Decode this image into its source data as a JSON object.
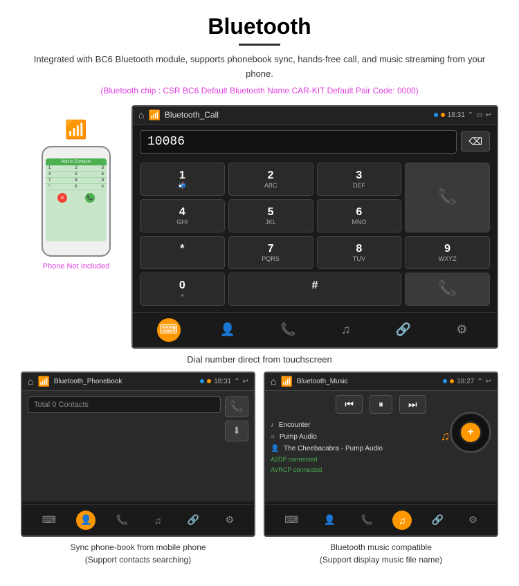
{
  "header": {
    "title": "Bluetooth",
    "subtitle": "Integrated with BC6 Bluetooth module, supports phonebook sync, hands-free call, and music streaming from your phone.",
    "specs": "(Bluetooth chip : CSR BC6    Default Bluetooth Name CAR-KIT    Default Pair Code: 0000)"
  },
  "main_screen": {
    "topbar_title": "Bluetooth_Call",
    "time": "18:31",
    "dial_number": "10086",
    "keys": [
      {
        "main": "1",
        "sub": ""
      },
      {
        "main": "2",
        "sub": "ABC"
      },
      {
        "main": "3",
        "sub": "DEF"
      },
      {
        "main": "*",
        "sub": ""
      },
      {
        "main": "4",
        "sub": "GHI"
      },
      {
        "main": "5",
        "sub": "JKL"
      },
      {
        "main": "6",
        "sub": "MNO"
      },
      {
        "main": "0",
        "sub": "+"
      },
      {
        "main": "7",
        "sub": "PQRS"
      },
      {
        "main": "8",
        "sub": "TUV"
      },
      {
        "main": "9",
        "sub": "WXYZ"
      },
      {
        "main": "#",
        "sub": ""
      }
    ],
    "caption": "Dial number direct from touchscreen"
  },
  "phone_label": "Phone Not Included",
  "phonebook_screen": {
    "topbar_title": "Bluetooth_Phonebook",
    "time": "18:31",
    "search_placeholder": "Total 0 Contacts",
    "caption_line1": "Sync phone-book from mobile phone",
    "caption_line2": "(Support contacts searching)"
  },
  "music_screen": {
    "topbar_title": "Bluetooth_Music",
    "time": "18:27",
    "tracks": [
      {
        "icon": "♪",
        "name": "Encounter"
      },
      {
        "icon": "○",
        "name": "Pump Audio"
      },
      {
        "icon": "👤",
        "name": "The Cheebacabra - Pump Audio"
      }
    ],
    "connected_status": [
      "A2DP connected",
      "AVRCP connected"
    ],
    "caption_line1": "Bluetooth music compatible",
    "caption_line2": "(Support display music file name)"
  }
}
